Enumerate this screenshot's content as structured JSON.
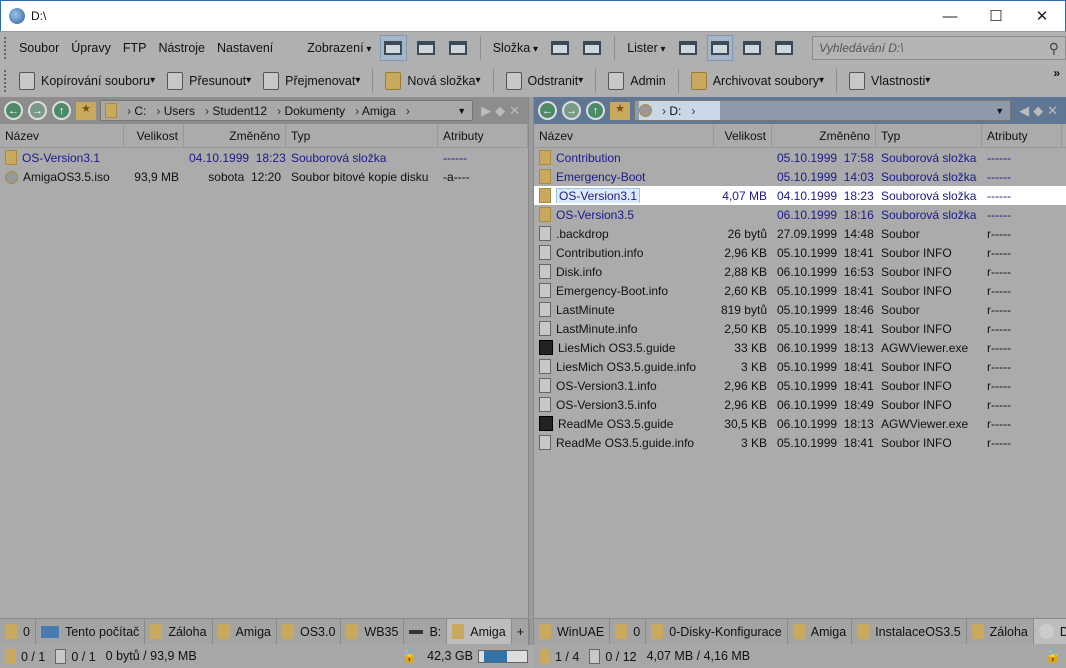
{
  "window": {
    "title": "D:\\"
  },
  "menu": {
    "items": [
      "Soubor",
      "Úpravy",
      "FTP",
      "Nástroje",
      "Nastavení"
    ],
    "zobrazeni": "Zobrazení",
    "slozka": "Složka",
    "lister": "Lister",
    "search_placeholder": "Vyhledávání D:\\"
  },
  "toolbar": {
    "copy": "Kopírování souboru",
    "move": "Přesunout",
    "rename": "Přejmenovat",
    "new_folder": "Nová složka",
    "delete": "Odstranit",
    "admin": "Admin",
    "archive": "Archivovat soubory",
    "properties": "Vlastnosti",
    "more": "»"
  },
  "columns": {
    "name": "Název",
    "size": "Velikost",
    "modified": "Změněno",
    "type": "Typ",
    "attrs": "Atributy"
  },
  "left": {
    "path": [
      "C:",
      "Users",
      "Student12",
      "Dokumenty",
      "Amiga"
    ],
    "files": [
      {
        "name": "OS-Version3.1",
        "size": "",
        "date": "04.10.1999",
        "time": "18:23",
        "type": "Souborová složka",
        "attrs": "------",
        "kind": "folder"
      },
      {
        "name": "AmigaOS3.5.iso",
        "size": "93,9 MB",
        "date": "sobota",
        "time": "12:20",
        "type": "Soubor bitové kopie disku",
        "attrs": "-a----",
        "kind": "iso"
      }
    ],
    "tabs": [
      {
        "label": "0",
        "icon": "folder"
      },
      {
        "label": "Tento počítač",
        "icon": "pc"
      },
      {
        "label": "Záloha",
        "icon": "folder"
      },
      {
        "label": "Amiga",
        "icon": "folder"
      },
      {
        "label": "OS3.0",
        "icon": "folder"
      },
      {
        "label": "WB35",
        "icon": "folder"
      },
      {
        "label": "B:",
        "icon": "drive"
      },
      {
        "label": "Amiga",
        "icon": "folder",
        "active": true
      }
    ],
    "status": {
      "folders": "0 / 1",
      "files": "0 / 1",
      "size": "0 bytů / 93,9 MB",
      "free": "42,3 GB",
      "used_fraction": 0.6
    }
  },
  "right": {
    "path": [
      "D:"
    ],
    "files": [
      {
        "name": "Contribution",
        "size": "",
        "date": "05.10.1999",
        "time": "17:58",
        "type": "Souborová složka",
        "attrs": "------",
        "kind": "folder"
      },
      {
        "name": "Emergency-Boot",
        "size": "",
        "date": "05.10.1999",
        "time": "14:03",
        "type": "Souborová složka",
        "attrs": "------",
        "kind": "folder"
      },
      {
        "name": "OS-Version3.1",
        "size": "4,07 MB",
        "date": "04.10.1999",
        "time": "18:23",
        "type": "Souborová složka",
        "attrs": "------",
        "kind": "folder",
        "selected": true
      },
      {
        "name": "OS-Version3.5",
        "size": "",
        "date": "06.10.1999",
        "time": "18:16",
        "type": "Souborová složka",
        "attrs": "------",
        "kind": "folder"
      },
      {
        "name": ".backdrop",
        "size": "26 bytů",
        "date": "27.09.1999",
        "time": "14:48",
        "type": "Soubor",
        "attrs": "r-----",
        "kind": "doc"
      },
      {
        "name": "Contribution.info",
        "size": "2,96 KB",
        "date": "05.10.1999",
        "time": "18:41",
        "type": "Soubor INFO",
        "attrs": "r-----",
        "kind": "doc"
      },
      {
        "name": "Disk.info",
        "size": "2,88 KB",
        "date": "06.10.1999",
        "time": "16:53",
        "type": "Soubor INFO",
        "attrs": "r-----",
        "kind": "doc"
      },
      {
        "name": "Emergency-Boot.info",
        "size": "2,60 KB",
        "date": "05.10.1999",
        "time": "18:41",
        "type": "Soubor INFO",
        "attrs": "r-----",
        "kind": "doc"
      },
      {
        "name": "LastMinute",
        "size": "819 bytů",
        "date": "05.10.1999",
        "time": "18:46",
        "type": "Soubor",
        "attrs": "r-----",
        "kind": "doc"
      },
      {
        "name": "LastMinute.info",
        "size": "2,50 KB",
        "date": "05.10.1999",
        "time": "18:41",
        "type": "Soubor INFO",
        "attrs": "r-----",
        "kind": "doc"
      },
      {
        "name": "LiesMich OS3.5.guide",
        "size": "33 KB",
        "date": "06.10.1999",
        "time": "18:13",
        "type": "AGWViewer.exe",
        "attrs": "r-----",
        "kind": "exe"
      },
      {
        "name": "LiesMich OS3.5.guide.info",
        "size": "3 KB",
        "date": "05.10.1999",
        "time": "18:41",
        "type": "Soubor INFO",
        "attrs": "r-----",
        "kind": "doc"
      },
      {
        "name": "OS-Version3.1.info",
        "size": "2,96 KB",
        "date": "05.10.1999",
        "time": "18:41",
        "type": "Soubor INFO",
        "attrs": "r-----",
        "kind": "doc"
      },
      {
        "name": "OS-Version3.5.info",
        "size": "2,96 KB",
        "date": "06.10.1999",
        "time": "18:49",
        "type": "Soubor INFO",
        "attrs": "r-----",
        "kind": "doc"
      },
      {
        "name": "ReadMe OS3.5.guide",
        "size": "30,5 KB",
        "date": "06.10.1999",
        "time": "18:13",
        "type": "AGWViewer.exe",
        "attrs": "r-----",
        "kind": "exe"
      },
      {
        "name": "ReadMe OS3.5.guide.info",
        "size": "3 KB",
        "date": "05.10.1999",
        "time": "18:41",
        "type": "Soubor INFO",
        "attrs": "r-----",
        "kind": "doc"
      }
    ],
    "tabs": [
      {
        "label": "WinUAE",
        "icon": "folder"
      },
      {
        "label": "0",
        "icon": "folder"
      },
      {
        "label": "0-Disky-Konfigurace",
        "icon": "folder"
      },
      {
        "label": "Amiga",
        "icon": "folder"
      },
      {
        "label": "InstalaceOS3.5",
        "icon": "folder"
      },
      {
        "label": "Záloha",
        "icon": "folder"
      },
      {
        "label": "D:",
        "icon": "cd",
        "active": true
      }
    ],
    "status": {
      "folders": "1 / 4",
      "files": "0 / 12",
      "size": "4,07 MB / 4,16 MB"
    }
  }
}
